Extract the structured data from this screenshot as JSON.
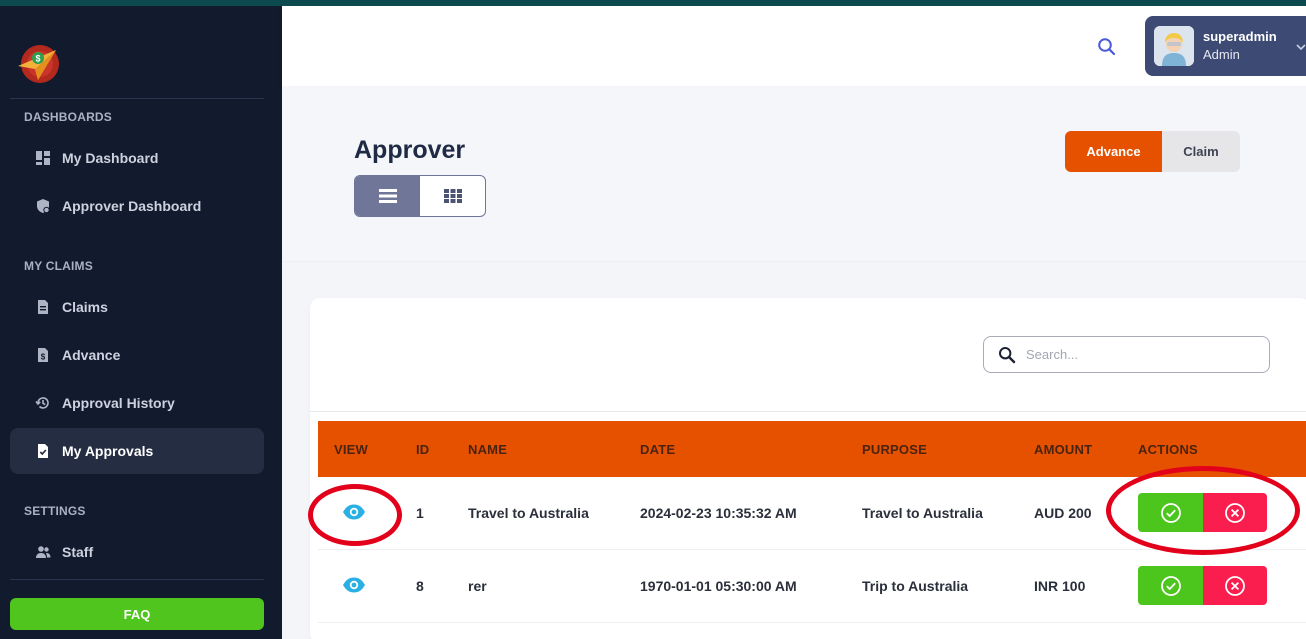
{
  "colors": {
    "sidebar_bg": "#121a2e",
    "accent_orange": "#e65100",
    "approve_green": "#4cc51c",
    "reject_red": "#fa1e4e",
    "faq_green": "#4fc51d",
    "highlight_red": "#e3001b"
  },
  "sidebar": {
    "sections": [
      {
        "title": "DASHBOARDS",
        "items": [
          {
            "label": "My Dashboard",
            "icon": "dashboard-icon"
          },
          {
            "label": "Approver Dashboard",
            "icon": "approver-dashboard-icon"
          }
        ]
      },
      {
        "title": "MY CLAIMS",
        "items": [
          {
            "label": "Claims",
            "icon": "document-icon"
          },
          {
            "label": "Advance",
            "icon": "money-document-icon"
          },
          {
            "label": "Approval History",
            "icon": "history-icon"
          },
          {
            "label": "My Approvals",
            "icon": "approval-document-icon",
            "active": true
          }
        ]
      },
      {
        "title": "SETTINGS",
        "items": [
          {
            "label": "Staff",
            "icon": "users-icon"
          }
        ]
      }
    ],
    "faq_label": "FAQ"
  },
  "header": {
    "user": {
      "name": "superadmin",
      "role": "Admin"
    }
  },
  "page": {
    "title": "Approver",
    "view_modes": [
      "list-view",
      "grid-view"
    ],
    "active_view": "list-view",
    "segments": [
      "Advance",
      "Claim"
    ],
    "active_segment": "Advance"
  },
  "search": {
    "placeholder": "Search...",
    "value": ""
  },
  "table": {
    "columns": [
      "VIEW",
      "ID",
      "NAME",
      "DATE",
      "PURPOSE",
      "AMOUNT",
      "ACTIONS"
    ],
    "rows": [
      {
        "id": "1",
        "name": "Travel to Australia",
        "date": "2024-02-23 10:35:32 AM",
        "purpose": "Travel to Australia",
        "amount": "AUD 200"
      },
      {
        "id": "8",
        "name": "rer",
        "date": "1970-01-01 05:30:00 AM",
        "purpose": "Trip to Australia",
        "amount": "INR 100"
      }
    ]
  }
}
